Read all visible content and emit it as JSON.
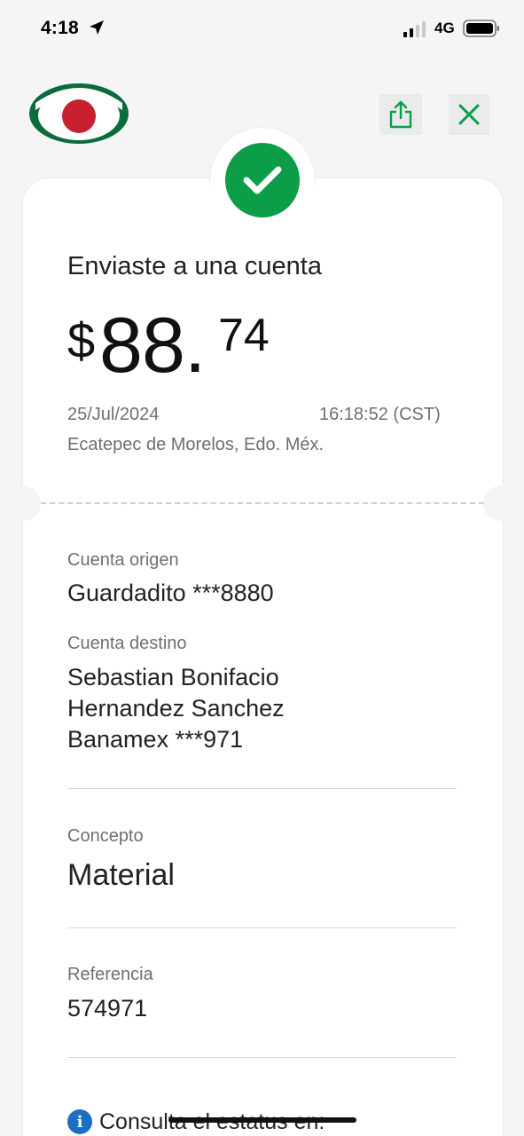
{
  "status_bar": {
    "time": "4:18",
    "network": "4G",
    "icons": [
      "location-arrow-icon",
      "signal-icon",
      "battery-icon"
    ]
  },
  "header": {
    "logo": "bank-logo",
    "actions": [
      "share-icon",
      "close-icon"
    ]
  },
  "colors": {
    "accent_green": "#0c9d48",
    "logo_red": "#c8202f",
    "logo_green": "#0b6b3a",
    "info_blue": "#1a6fc2"
  },
  "receipt": {
    "title": "Enviaste a una cuenta",
    "amount": {
      "currency": "$",
      "integer": "88.",
      "decimal": "74"
    },
    "date": "25/Jul/2024",
    "time": "16:18:52 (CST)",
    "location": "Ecatepec de Morelos, Edo. Méx."
  },
  "details": {
    "origin_label": "Cuenta origen",
    "origin_value": "Guardadito ***8880",
    "destination_label": "Cuenta destino",
    "destination_line1": "Sebastian Bonifacio",
    "destination_line2": "Hernandez Sanchez",
    "destination_line3": "Banamex ***971",
    "concept_label": "Concepto",
    "concept_value": "Material",
    "reference_label": "Referencia",
    "reference_value": "574971",
    "status_text": "Consulta el estatus en:"
  }
}
